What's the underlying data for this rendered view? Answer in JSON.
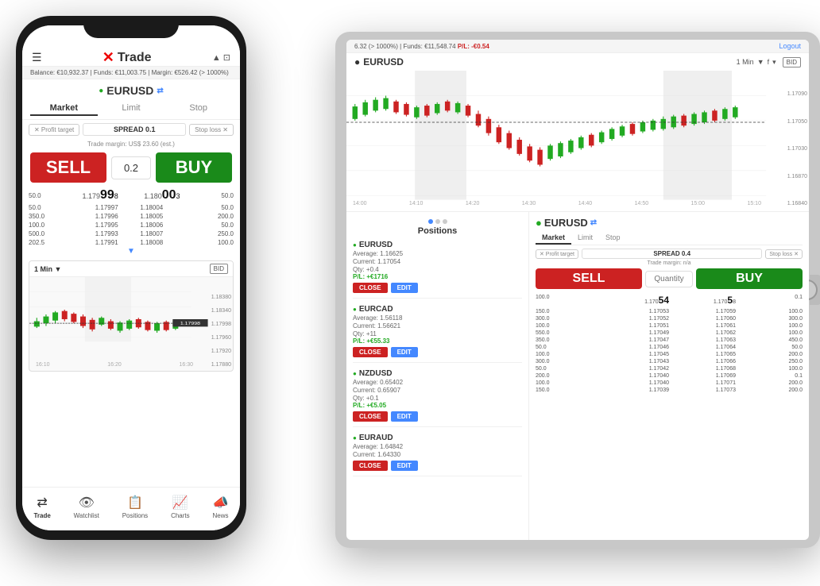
{
  "scene": {
    "background": "#ffffff"
  },
  "phone": {
    "header": {
      "brand": "Trade",
      "x_logo": "✕"
    },
    "status_bar": {
      "text": "Balance: €10,932.37 | Funds: €11,003.75 | Margin: €526.42 (> 1000%)"
    },
    "pair": {
      "dot": "●",
      "name": "EURUSD",
      "refresh": "⇄"
    },
    "tabs": [
      "Market",
      "Limit",
      "Stop"
    ],
    "active_tab": "Market",
    "order_inputs": {
      "profit_target": "✕ Profit target",
      "spread": "SPREAD 0.1",
      "stop_loss": "Stop loss ✕"
    },
    "trade_margin": "Trade margin: US$ 23.60 (est.)",
    "sell_label": "SELL",
    "buy_label": "BUY",
    "qty": "0.2",
    "order_book": [
      {
        "qty": "50.0",
        "bid": "1.17998",
        "ask": "1.18003",
        "qty2": "50.0"
      },
      {
        "qty": "50.0",
        "bid": "1.17997",
        "ask": "1.18004",
        "qty2": "50.0"
      },
      {
        "qty": "350.0",
        "bid": "1.17996",
        "ask": "1.18005",
        "qty2": "200.0"
      },
      {
        "qty": "100.0",
        "bid": "1.17995",
        "ask": "1.18006",
        "qty2": "50.0"
      },
      {
        "qty": "500.0",
        "bid": "1.17993",
        "ask": "1.18007",
        "qty2": "250.0"
      },
      {
        "qty": "202.5",
        "bid": "1.17991",
        "ask": "1.18008",
        "qty2": "100.0"
      }
    ],
    "highlight_bid": "998",
    "highlight_bid_prefix": "1.179",
    "highlight_ask": "00",
    "highlight_ask_prefix": "1.180",
    "highlight_ask_suffix": "3",
    "chart": {
      "timeframe": "1 Min",
      "bid_tag": "BID",
      "prices": [
        "1.18380",
        "1.18340",
        "1.17998",
        "1.17960",
        "1.17920",
        "1.17880"
      ],
      "times": [
        "16:10",
        "16:20",
        "16:30"
      ],
      "current_price": "1.17998"
    },
    "nav": [
      {
        "icon": "⇄",
        "label": "Trade",
        "active": true
      },
      {
        "icon": "👁",
        "label": "Watchlist",
        "active": false
      },
      {
        "icon": "📋",
        "label": "Positions",
        "active": false
      },
      {
        "icon": "📈",
        "label": "Charts",
        "active": false
      },
      {
        "icon": "📣",
        "label": "News",
        "active": false
      }
    ]
  },
  "tablet": {
    "status_bar": {
      "left": "6.32 (> 1000%) | Funds: €11,548.74",
      "pnl_label": "P/L:",
      "pnl_value": "-€0.54",
      "logout": "Logout"
    },
    "chart": {
      "pair_dot": "●",
      "pair_name": "EURUSD",
      "timeframe": "1 Min",
      "bid_tag": "BID",
      "prices": [
        "1.17090",
        "1.17050",
        "1.17030",
        "1.16870",
        "1.16840"
      ],
      "times": [
        "14:00",
        "14:10",
        "14:20",
        "14:30",
        "14:40",
        "14:50",
        "15:00",
        "15:10"
      ]
    },
    "positions": {
      "header": "Positions",
      "items": [
        {
          "name": "EURUSD",
          "average": "Average: 1.16625",
          "current": "Current: 1.17054",
          "qty": "Qty: +0.4",
          "pnl": "P/L: +€1716",
          "pnl_positive": true
        },
        {
          "name": "EURCAD",
          "average": "Average: 1.56118",
          "current": "Current: 1.56621",
          "qty": "Qty: +11",
          "pnl": "P/L: +€55.33",
          "pnl_positive": true
        },
        {
          "name": "NZDUSD",
          "average": "Average: 0.65402",
          "current": "Current: 0.65907",
          "qty": "Qty: +0.1",
          "pnl": "P/L: +€5.05",
          "pnl_positive": true
        },
        {
          "name": "EURAUD",
          "average": "Average: 1.64842",
          "current": "Current: 1.64330",
          "qty": "",
          "pnl": "",
          "pnl_positive": false
        }
      ],
      "close_label": "CLOSE",
      "edit_label": "EDIT"
    },
    "trade_panel": {
      "pair_dot": "●",
      "pair_name": "EURUSD",
      "pair_refresh": "⇄",
      "tabs": [
        "Market",
        "Limit",
        "Stop"
      ],
      "active_tab": "Market",
      "profit_target": "✕ Profit target",
      "spread": "SPREAD 0.4",
      "stop_loss": "Stop loss ✕",
      "trade_margin": "Trade margin: n/a",
      "sell_label": "SELL",
      "buy_label": "BUY",
      "qty_placeholder": "Quantity",
      "order_book": [
        {
          "qty": "100.0",
          "bid": "1.17054",
          "ask": "1.17058",
          "qty2": "0.1"
        },
        {
          "qty": "150.0",
          "bid": "1.17053",
          "ask": "1.17059",
          "qty2": "100.0"
        },
        {
          "qty": "300.0",
          "bid": "1.17052",
          "ask": "1.17060",
          "qty2": "300.0"
        },
        {
          "qty": "100.0",
          "bid": "1.17051",
          "ask": "1.17061",
          "qty2": "100.0"
        },
        {
          "qty": "550.0",
          "bid": "1.17049",
          "ask": "1.17062",
          "qty2": "100.0"
        },
        {
          "qty": "350.0",
          "bid": "1.17047",
          "ask": "1.17063",
          "qty2": "450.0"
        },
        {
          "qty": "50.0",
          "bid": "1.17046",
          "ask": "1.17064",
          "qty2": "50.0"
        },
        {
          "qty": "100.0",
          "bid": "1.17045",
          "ask": "1.17065",
          "qty2": "200.0"
        },
        {
          "qty": "300.0",
          "bid": "1.17043",
          "ask": "1.17066",
          "qty2": "250.0"
        },
        {
          "qty": "50.0",
          "bid": "1.17042",
          "ask": "1.17068",
          "qty2": "100.0"
        },
        {
          "qty": "200.0",
          "bid": "1.17040",
          "ask": "1.17069",
          "qty2": "0.1"
        },
        {
          "qty": "100.0",
          "bid": "1.17040",
          "ask": "1.17071",
          "qty2": "200.0"
        },
        {
          "qty": "150.0",
          "bid": "1.17039",
          "ask": "1.17073",
          "qty2": "200.0"
        }
      ],
      "highlight_bid_prefix": "1.170",
      "highlight_bid": "54",
      "highlight_ask_prefix": "1.170",
      "highlight_ask": "5",
      "highlight_ask_suffix": "8"
    }
  }
}
